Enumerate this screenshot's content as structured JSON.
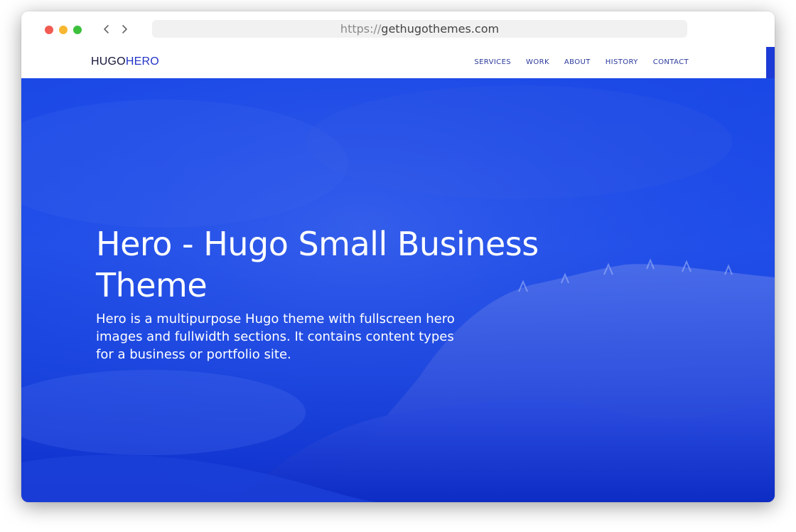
{
  "browser": {
    "url_scheme": "https://",
    "url_host": "gethugothemes.com",
    "back_icon": "chevron-left-icon",
    "forward_icon": "chevron-right-icon"
  },
  "site": {
    "logo_part1": "HUGO",
    "logo_part2": "HERO",
    "nav": {
      "services": "SERVICES",
      "work": "WORK",
      "about": "ABOUT",
      "history": "HISTORY",
      "contact": "CONTACT"
    }
  },
  "hero": {
    "title": "Hero - Hugo Small Business Theme",
    "text": "Hero is a multipurpose Hugo theme with fullscreen hero images and fullwidth sections. It contains content types for a business or portfolio site."
  },
  "colors": {
    "hero_blue": "#1a48e6",
    "logo_dark": "#15163a",
    "logo_accent": "#2233c8",
    "nav_text": "#2b3a9c"
  }
}
